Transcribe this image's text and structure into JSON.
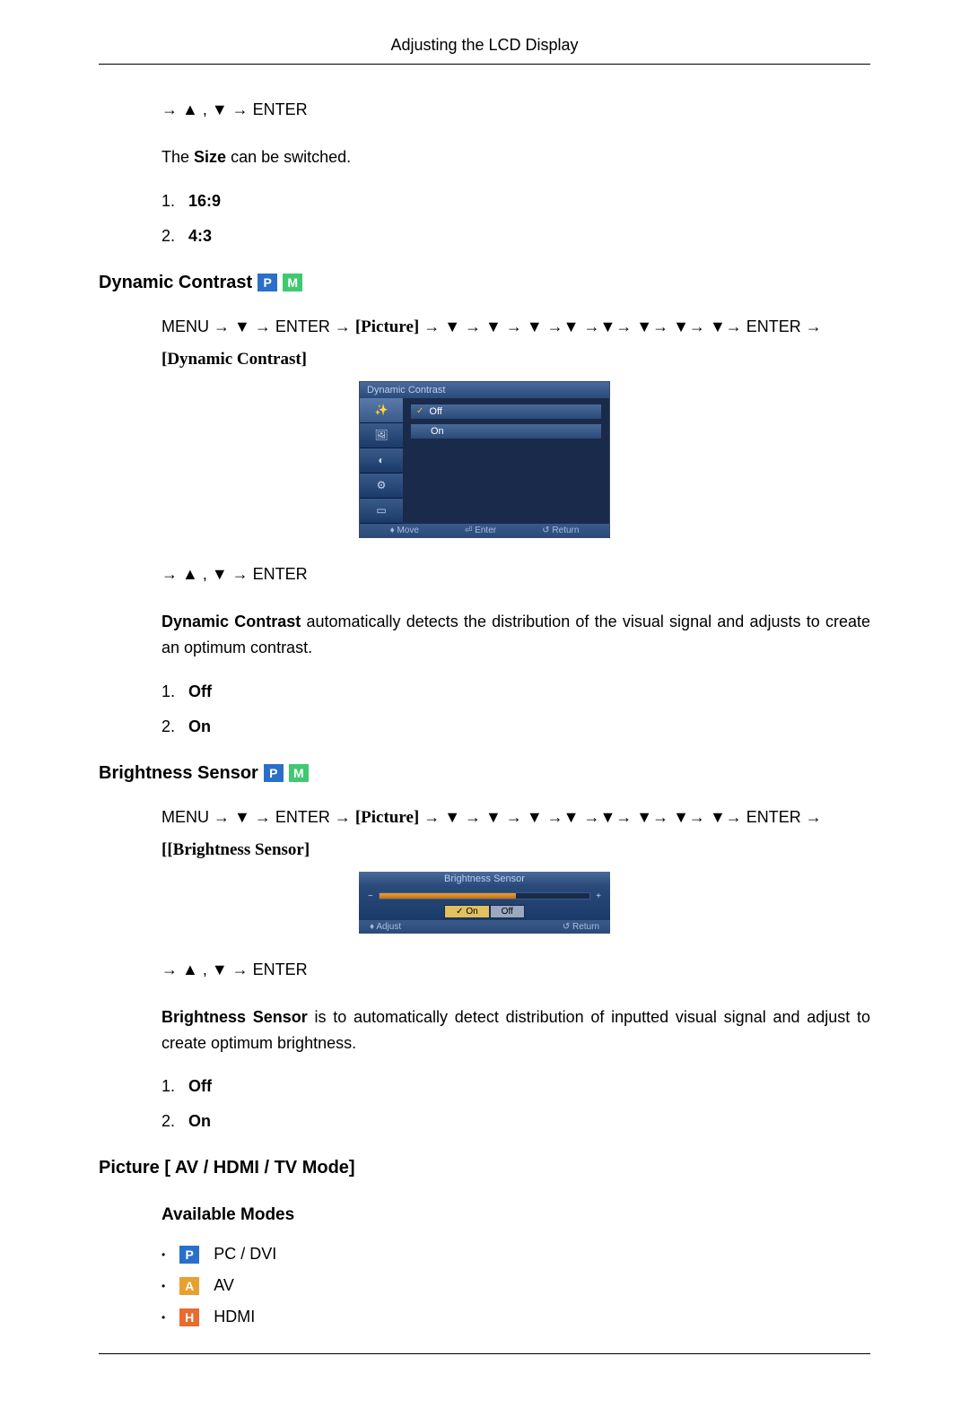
{
  "header": {
    "title": "Adjusting the LCD Display"
  },
  "size_section": {
    "nav": "→ ▲ , ▼ → ENTER",
    "desc_pre": "The ",
    "desc_bold": "Size",
    "desc_post": " can be switched.",
    "items": [
      {
        "num": "1.",
        "label": "16:9"
      },
      {
        "num": "2.",
        "label": "4:3"
      }
    ]
  },
  "dynamic_contrast": {
    "heading": "Dynamic Contrast",
    "path_pre": "MENU → ▼ → ENTER → ",
    "path_picture": "[Picture]",
    "path_mid": " → ▼ → ▼ → ▼ →▼ →▼→ ▼→ ▼→ ▼→ ENTER → ",
    "path_bracket": "[Dynamic Contrast]",
    "osd": {
      "title": "Dynamic Contrast",
      "opt_off": "Off",
      "opt_on": "On",
      "footer_move": "♦ Move",
      "footer_enter": "⏎ Enter",
      "footer_return": "↺ Return"
    },
    "nav": "→ ▲ , ▼ → ENTER",
    "desc_bold": "Dynamic Contrast",
    "desc_post": " automatically detects the distribution of the visual signal and adjusts to create an optimum contrast.",
    "items": [
      {
        "num": "1.",
        "label": "Off"
      },
      {
        "num": "2.",
        "label": "On"
      }
    ]
  },
  "brightness_sensor": {
    "heading": "Brightness Sensor",
    "path_pre": "MENU → ▼ → ENTER → ",
    "path_picture": "[Picture]",
    "path_mid": " → ▼ → ▼ → ▼ →▼ →▼→ ▼→ ▼→ ▼→ ENTER → ",
    "path_bracket": "[[Brightness Sensor]",
    "osd": {
      "title": "Brightness Sensor",
      "on": "On",
      "off": "Off",
      "footer_adjust": "♦ Adjust",
      "footer_return": "↺ Return"
    },
    "nav": "→ ▲ , ▼ → ENTER",
    "desc_bold": "Brightness Sensor",
    "desc_post": " is to automatically detect distribution of inputted visual signal and adjust to create optimum brightness.",
    "items": [
      {
        "num": "1.",
        "label": "Off"
      },
      {
        "num": "2.",
        "label": "On"
      }
    ]
  },
  "picture_mode": {
    "heading": "Picture [ AV / HDMI / TV Mode]",
    "sub_heading": "Available Modes",
    "modes": {
      "p_letter": "P",
      "p_label": "PC / DVI",
      "a_letter": "A",
      "a_label": "AV",
      "h_letter": "H",
      "h_label": "HDMI"
    }
  },
  "badges": {
    "p": "P",
    "m": "M"
  },
  "check": "✓"
}
